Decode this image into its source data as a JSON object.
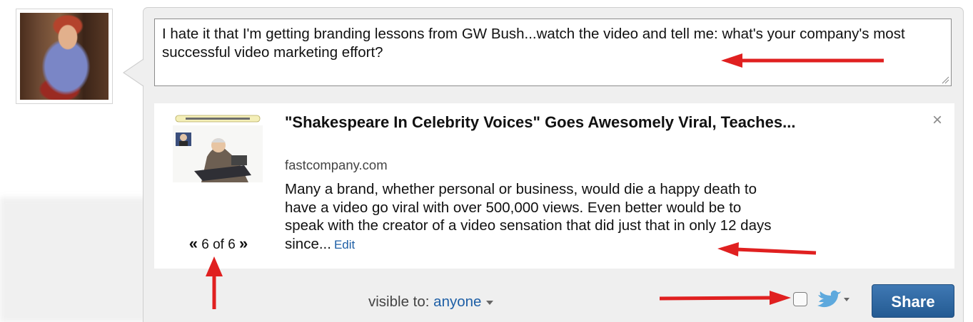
{
  "composer": {
    "message": "I hate it that I'm getting branding lessons from GW Bush...watch the video and tell me: what's your company's most successful video marketing effort?"
  },
  "preview": {
    "title": "\"Shakespeare In Celebrity Voices\" Goes Awesomely Viral, Teaches...",
    "domain": "fastcompany.com",
    "description": "Many a brand, whether personal or business, would die a happy death to have a video go viral with over 500,000 views. Even better would be to speak with the creator of a video sensation that did just that in only 12 days since...",
    "edit_label": "Edit",
    "close_label": "×",
    "pager": {
      "prev": "«",
      "label": "6 of 6",
      "next": "»"
    }
  },
  "footer": {
    "visible_to_label": "visible to:",
    "visibility_value": "anyone",
    "share_label": "Share"
  },
  "colors": {
    "link": "#1e5fa6",
    "share_button": "#2f6aa6",
    "annotation_arrow": "#e02020",
    "panel_background": "#efefef"
  },
  "icons": [
    "profile-photo",
    "video-thumbnail",
    "close-icon",
    "caret-down-icon",
    "checkbox",
    "twitter-bird-icon",
    "resize-handle"
  ]
}
